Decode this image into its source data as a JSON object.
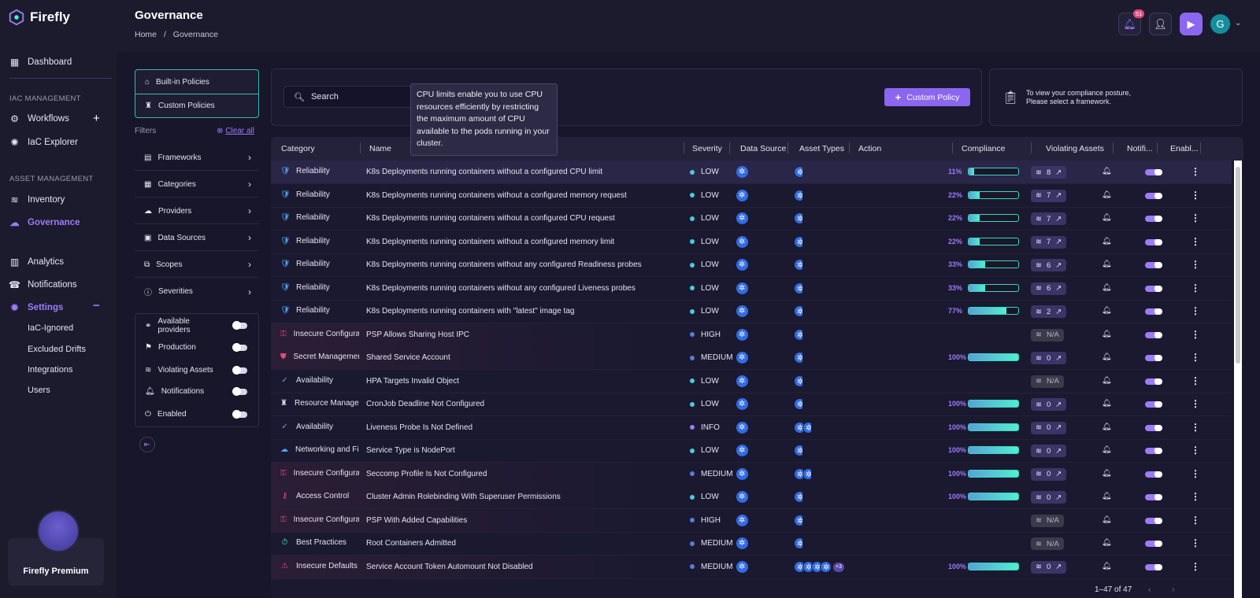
{
  "app": {
    "name": "Firefly"
  },
  "sidebar": {
    "dashboard": "Dashboard",
    "iac_section": "IAC MANAGEMENT",
    "workflows": "Workflows",
    "iac_explorer": "IaC Explorer",
    "asset_section": "ASSET MANAGEMENT",
    "inventory": "Inventory",
    "governance": "Governance",
    "analytics": "Analytics",
    "notifications": "Notifications",
    "settings": "Settings",
    "settings_items": [
      "IaC-Ignored",
      "Excluded Drifts",
      "Integrations",
      "Users"
    ],
    "premium": "Firefly Premium"
  },
  "header": {
    "title": "Governance",
    "breadcrumb_home": "Home",
    "breadcrumb_sep": "/",
    "breadcrumb_current": "Governance",
    "notification_count": "51",
    "avatar_initial": "G"
  },
  "policy_tabs": {
    "builtin": "Built-in Policies",
    "custom": "Custom Policies"
  },
  "filters": {
    "label": "Filters",
    "clear": "Clear all",
    "items": [
      "Frameworks",
      "Categories",
      "Providers",
      "Data Sources",
      "Scopes",
      "Severities"
    ],
    "toggles": [
      "Available providers",
      "Production",
      "Violating Assets",
      "Notifications",
      "Enabled"
    ]
  },
  "search": {
    "placeholder": "Search"
  },
  "custom_policy_button": "Custom Policy",
  "compliance_hint": {
    "line1": "To view your compliance posture,",
    "line2": "Please select a framework."
  },
  "tooltip": "CPU limits enable you to use CPU resources efficiently by restricting the maximum amount of CPU available to the pods running in your cluster.",
  "table": {
    "columns": [
      "Category",
      "Name",
      "Severity",
      "Data Source",
      "Asset Types",
      "Action",
      "Compliance",
      "Violating Assets",
      "Notifi...",
      "Enabl..."
    ],
    "rows": [
      {
        "category": "Reliability",
        "name": "K8s Deployments running containers without a configured CPU limit",
        "severity": "LOW",
        "compliance": "11%",
        "violating": "8"
      },
      {
        "category": "Reliability",
        "name": "K8s Deployments running containers without a configured memory request",
        "severity": "LOW",
        "compliance": "22%",
        "violating": "7"
      },
      {
        "category": "Reliability",
        "name": "K8s Deployments running containers without a configured CPU request",
        "severity": "LOW",
        "compliance": "22%",
        "violating": "7"
      },
      {
        "category": "Reliability",
        "name": "K8s Deployments running containers without a configured memory limit",
        "severity": "LOW",
        "compliance": "22%",
        "violating": "7"
      },
      {
        "category": "Reliability",
        "name": "K8s Deployments running containers without any configured Readiness probes",
        "severity": "LOW",
        "compliance": "33%",
        "violating": "6"
      },
      {
        "category": "Reliability",
        "name": "K8s Deployments running containers without any configured Liveness probes",
        "severity": "LOW",
        "compliance": "33%",
        "violating": "6"
      },
      {
        "category": "Reliability",
        "name": "K8s Deployments running containers with \"latest\" image tag",
        "severity": "LOW",
        "compliance": "77%",
        "violating": "2"
      },
      {
        "category": "Insecure Configurati",
        "name": "PSP Allows Sharing Host IPC",
        "severity": "HIGH",
        "compliance": "",
        "violating": "N/A"
      },
      {
        "category": "Secret Managemen",
        "name": "Shared Service Account",
        "severity": "MEDIUM",
        "compliance": "100%",
        "violating": "0"
      },
      {
        "category": "Availability",
        "name": "HPA Targets Invalid Object",
        "severity": "LOW",
        "compliance": "",
        "violating": "N/A"
      },
      {
        "category": "Resource Managem",
        "name": "CronJob Deadline Not Configured",
        "severity": "LOW",
        "compliance": "100%",
        "violating": "0"
      },
      {
        "category": "Availability",
        "name": "Liveness Probe Is Not Defined",
        "severity": "INFO",
        "compliance": "100%",
        "violating": "0"
      },
      {
        "category": "Networking and Fire",
        "name": "Service Type is NodePort",
        "severity": "LOW",
        "compliance": "100%",
        "violating": "0"
      },
      {
        "category": "Insecure Configurati",
        "name": "Seccomp Profile Is Not Configured",
        "severity": "MEDIUM",
        "compliance": "100%",
        "violating": "0"
      },
      {
        "category": "Access Control",
        "name": "Cluster Admin Rolebinding With Superuser Permissions",
        "severity": "LOW",
        "compliance": "100%",
        "violating": "0"
      },
      {
        "category": "Insecure Configurati",
        "name": "PSP With Added Capabilities",
        "severity": "HIGH",
        "compliance": "",
        "violating": "N/A"
      },
      {
        "category": "Best Practices",
        "name": "Root Containers Admitted",
        "severity": "MEDIUM",
        "compliance": "",
        "violating": "N/A"
      },
      {
        "category": "Insecure Defaults",
        "name": "Service Account Token Automount Not Disabled",
        "severity": "MEDIUM",
        "compliance": "100%",
        "violating": "0",
        "asset_more": "+3"
      }
    ]
  },
  "pager": "1–47 of 47",
  "colors": {
    "accent": "#9c7cf7",
    "teal": "#3bd3c3",
    "low": "#4fc8e0",
    "medium": "#5b7bd6",
    "high": "#5b7bd6",
    "info": "#9c7cf7"
  }
}
